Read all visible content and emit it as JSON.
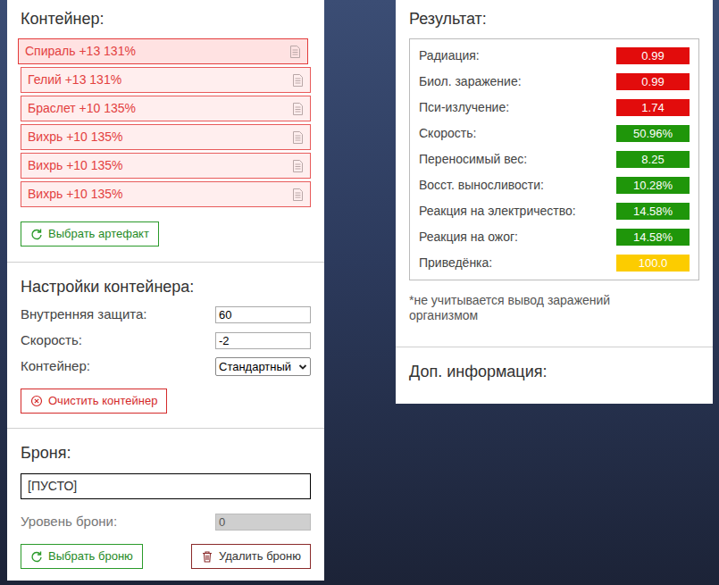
{
  "container": {
    "title": "Контейнер:",
    "artifacts": [
      {
        "label": "Спираль +13 131%",
        "selected": true
      },
      {
        "label": "Гелий +13 131%",
        "selected": false
      },
      {
        "label": "Браслет +10 135%",
        "selected": false
      },
      {
        "label": "Вихрь +10 135%",
        "selected": false
      },
      {
        "label": "Вихрь +10 135%",
        "selected": false
      },
      {
        "label": "Вихрь +10 135%",
        "selected": false
      }
    ],
    "choose_button": "Выбрать артефакт"
  },
  "settings": {
    "title": "Настройки контейнера:",
    "fields": [
      {
        "label": "Внутренняя защита:",
        "value": "60",
        "kind": "input"
      },
      {
        "label": "Скорость:",
        "value": "-2",
        "kind": "input"
      },
      {
        "label": "Контейнер:",
        "value": "Стандартный",
        "kind": "select"
      }
    ],
    "clear_button": "Очистить контейнер"
  },
  "armor": {
    "title": "Броня:",
    "value": "[ПУСТО]",
    "level_label": "Уровень брони:",
    "level_value": "0",
    "level_disabled": true,
    "choose_button": "Выбрать броню",
    "delete_button": "Удалить броню"
  },
  "result": {
    "title": "Результат:",
    "rows": [
      {
        "label": "Радиация:",
        "value": "0.99",
        "color": "#e20c0c"
      },
      {
        "label": "Биол. заражение:",
        "value": "0.99",
        "color": "#e20c0c"
      },
      {
        "label": "Пси-излучение:",
        "value": "1.74",
        "color": "#e20c0c"
      },
      {
        "label": "Скорость:",
        "value": "50.96%",
        "color": "#1f960a"
      },
      {
        "label": "Переносимый вес:",
        "value": "8.25",
        "color": "#1f960a"
      },
      {
        "label": "Восст. выносливости:",
        "value": "10.28%",
        "color": "#1f960a"
      },
      {
        "label": "Реакция на электричество:",
        "value": "14.58%",
        "color": "#1f960a"
      },
      {
        "label": "Реакция на ожог:",
        "value": "14.58%",
        "color": "#1f960a"
      },
      {
        "label": "Приведёнка:",
        "value": "100.0",
        "color": "#fccc00"
      }
    ],
    "note": "*не учитывается вывод заражений организмом"
  },
  "extra": {
    "title": "Доп. информация:"
  }
}
